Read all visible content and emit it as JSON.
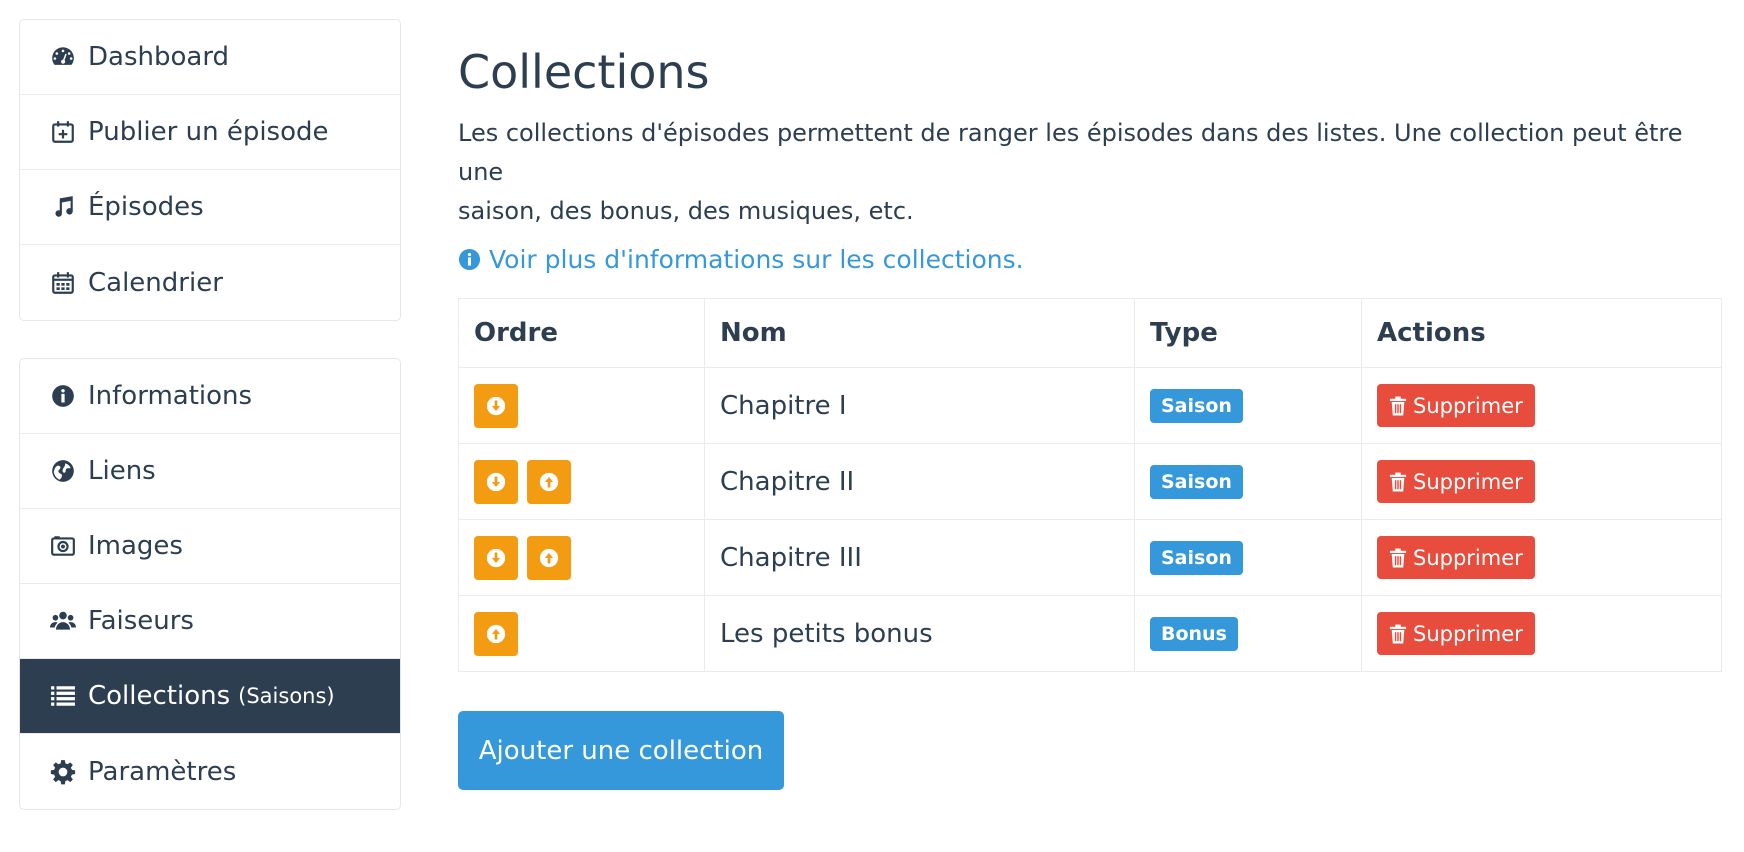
{
  "sidebar": {
    "group1": [
      {
        "label": "Dashboard",
        "icon": "dashboard-icon"
      },
      {
        "label": "Publier un épisode",
        "icon": "calendar-plus-icon"
      },
      {
        "label": "Épisodes",
        "icon": "music-icon"
      },
      {
        "label": "Calendrier",
        "icon": "calendar-icon"
      }
    ],
    "group2": [
      {
        "label": "Informations",
        "icon": "info-icon"
      },
      {
        "label": "Liens",
        "icon": "globe-icon"
      },
      {
        "label": "Images",
        "icon": "camera-icon"
      },
      {
        "label": "Faiseurs",
        "icon": "users-icon"
      },
      {
        "label": "Collections",
        "sub": "(Saisons)",
        "icon": "list-icon",
        "active": true
      },
      {
        "label": "Paramètres",
        "icon": "gear-icon"
      }
    ]
  },
  "main": {
    "title": "Collections",
    "intro_line1": "Les collections d'épisodes permettent de ranger les épisodes dans des listes. Une collection peut être une",
    "intro_line2": "saison, des bonus, des musiques, etc.",
    "info_link": "Voir plus d'informations sur les collections.",
    "table": {
      "headers": [
        "Ordre",
        "Nom",
        "Type",
        "Actions"
      ],
      "rows": [
        {
          "name": "Chapitre I",
          "type": "Saison",
          "action": "Supprimer",
          "order_buttons": [
            "down"
          ]
        },
        {
          "name": "Chapitre II",
          "type": "Saison",
          "action": "Supprimer",
          "order_buttons": [
            "down",
            "up"
          ]
        },
        {
          "name": "Chapitre III",
          "type": "Saison",
          "action": "Supprimer",
          "order_buttons": [
            "down",
            "up"
          ]
        },
        {
          "name": "Les petits bonus",
          "type": "Bonus",
          "action": "Supprimer",
          "order_buttons": [
            "up"
          ]
        }
      ]
    },
    "add_button": "Ajouter une collection"
  },
  "colors": {
    "primary": "#3498db",
    "dark": "#2c3e50",
    "warning": "#f39c12",
    "danger": "#e74c3c"
  }
}
